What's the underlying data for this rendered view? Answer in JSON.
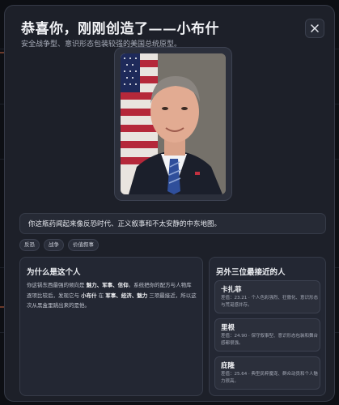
{
  "modal": {
    "title": "恭喜你，刚刚创造了——小布什",
    "subtitle": "安全战争型、意识形态包装较强的美国总统原型。",
    "close_icon": "close-icon"
  },
  "portrait": {
    "icon": "portrait-photo"
  },
  "quote": "你这瓶药闻起来像反恐时代、正义叙事和不太安静的中东地图。",
  "tags": [
    "反恐",
    "战争",
    "价值叙事"
  ],
  "why": {
    "title": "为什么是这个人",
    "parts": [
      {
        "t": "你这锅东西最强的倾向是 ",
        "b": false
      },
      {
        "t": "魅力、军事、信仰",
        "b": true
      },
      {
        "t": "。系统把你的配方与人物库逐项比较后，发现它与 ",
        "b": false
      },
      {
        "t": "小布什",
        "b": true
      },
      {
        "t": " 在 ",
        "b": false
      },
      {
        "t": "军事、经济、魅力",
        "b": true
      },
      {
        "t": " 三项最接近，所以这次从黑盒里跳出来的是他。",
        "b": false
      }
    ]
  },
  "matches": {
    "title": "另外三位最接近的人",
    "items": [
      {
        "name": "卡扎菲",
        "desc": "差值：23.21 · 个人色彩强烈、狂傲化、意识形态与荒诞感并存。"
      },
      {
        "name": "里根",
        "desc": "差值：24.90 · 保守叙事型、意识形态包装和舞台感都很强。"
      },
      {
        "name": "庇隆",
        "desc": "差值：25.64 · 典型民粹魔宠、群众动员和个人魅力很高。"
      }
    ]
  }
}
